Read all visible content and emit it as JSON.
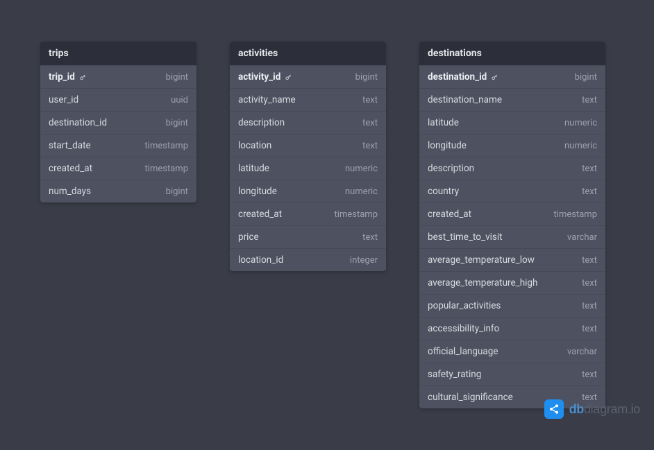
{
  "tables": [
    {
      "name": "trips",
      "wide": false,
      "columns": [
        {
          "name": "trip_id",
          "type": "bigint",
          "pk": true
        },
        {
          "name": "user_id",
          "type": "uuid",
          "pk": false
        },
        {
          "name": "destination_id",
          "type": "bigint",
          "pk": false
        },
        {
          "name": "start_date",
          "type": "timestamp",
          "pk": false
        },
        {
          "name": "created_at",
          "type": "timestamp",
          "pk": false
        },
        {
          "name": "num_days",
          "type": "bigint",
          "pk": false
        }
      ]
    },
    {
      "name": "activities",
      "wide": false,
      "columns": [
        {
          "name": "activity_id",
          "type": "bigint",
          "pk": true
        },
        {
          "name": "activity_name",
          "type": "text",
          "pk": false
        },
        {
          "name": "description",
          "type": "text",
          "pk": false
        },
        {
          "name": "location",
          "type": "text",
          "pk": false
        },
        {
          "name": "latitude",
          "type": "numeric",
          "pk": false
        },
        {
          "name": "longitude",
          "type": "numeric",
          "pk": false
        },
        {
          "name": "created_at",
          "type": "timestamp",
          "pk": false
        },
        {
          "name": "price",
          "type": "text",
          "pk": false
        },
        {
          "name": "location_id",
          "type": "integer",
          "pk": false
        }
      ]
    },
    {
      "name": "destinations",
      "wide": true,
      "columns": [
        {
          "name": "destination_id",
          "type": "bigint",
          "pk": true
        },
        {
          "name": "destination_name",
          "type": "text",
          "pk": false
        },
        {
          "name": "latitude",
          "type": "numeric",
          "pk": false
        },
        {
          "name": "longitude",
          "type": "numeric",
          "pk": false
        },
        {
          "name": "description",
          "type": "text",
          "pk": false
        },
        {
          "name": "country",
          "type": "text",
          "pk": false
        },
        {
          "name": "created_at",
          "type": "timestamp",
          "pk": false
        },
        {
          "name": "best_time_to_visit",
          "type": "varchar",
          "pk": false
        },
        {
          "name": "average_temperature_low",
          "type": "text",
          "pk": false
        },
        {
          "name": "average_temperature_high",
          "type": "text",
          "pk": false
        },
        {
          "name": "popular_activities",
          "type": "text",
          "pk": false
        },
        {
          "name": "accessibility_info",
          "type": "text",
          "pk": false
        },
        {
          "name": "official_language",
          "type": "varchar",
          "pk": false
        },
        {
          "name": "safety_rating",
          "type": "text",
          "pk": false
        },
        {
          "name": "cultural_significance",
          "type": "text",
          "pk": false
        }
      ]
    }
  ],
  "watermark": {
    "prefix": "db",
    "suffix": "diagram.io"
  }
}
